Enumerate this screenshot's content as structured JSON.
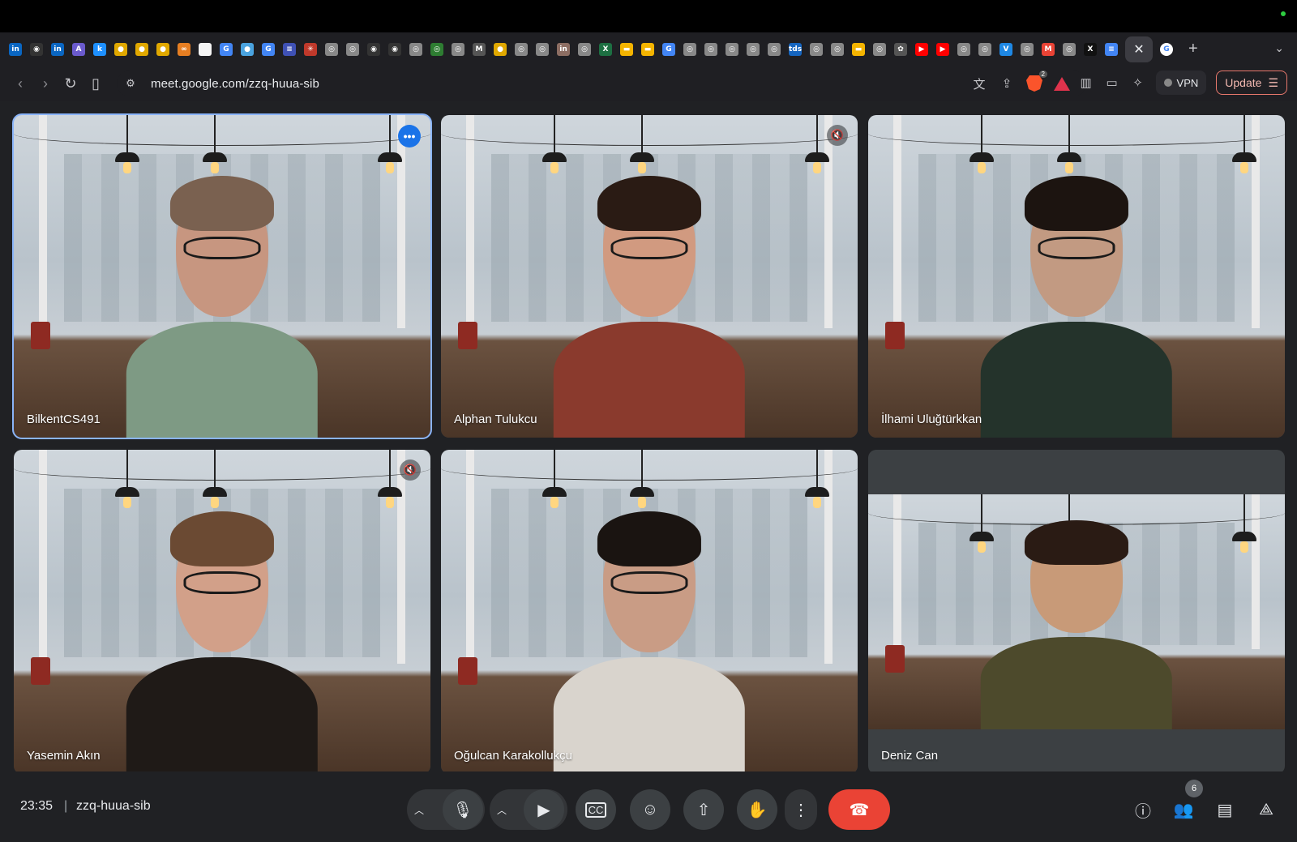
{
  "browser": {
    "url": "meet.google.com/zzq-huua-sib",
    "vpn_label": "VPN",
    "update_label": "Update",
    "brave_badge": "2",
    "favicons": [
      {
        "icon": "linkedin-icon",
        "color": "#0a66c2",
        "glyph": "in"
      },
      {
        "icon": "github-icon",
        "color": "#333",
        "glyph": "◉"
      },
      {
        "icon": "linkedin-icon",
        "color": "#0a66c2",
        "glyph": "in"
      },
      {
        "icon": "site-icon",
        "color": "#6a5acd",
        "glyph": "A"
      },
      {
        "icon": "site-icon",
        "color": "#1e90ff",
        "glyph": "k"
      },
      {
        "icon": "site-icon",
        "color": "#e0a800",
        "glyph": "●"
      },
      {
        "icon": "site-icon",
        "color": "#e0a800",
        "glyph": "●"
      },
      {
        "icon": "site-icon",
        "color": "#e0a800",
        "glyph": "●"
      },
      {
        "icon": "site-icon",
        "color": "#e67e22",
        "glyph": "∞"
      },
      {
        "icon": "site-icon",
        "color": "#f4f4f4",
        "glyph": ""
      },
      {
        "icon": "google-icon",
        "color": "#4285f4",
        "glyph": "G"
      },
      {
        "icon": "site-icon",
        "color": "#4aa3df",
        "glyph": "●"
      },
      {
        "icon": "google-icon",
        "color": "#4285f4",
        "glyph": "G"
      },
      {
        "icon": "site-icon",
        "color": "#3f51b5",
        "glyph": "≡"
      },
      {
        "icon": "site-icon",
        "color": "#c0392b",
        "glyph": "✳"
      },
      {
        "icon": "site-icon",
        "color": "#888",
        "glyph": "◎"
      },
      {
        "icon": "site-icon",
        "color": "#888",
        "glyph": "◎"
      },
      {
        "icon": "github-icon",
        "color": "#333",
        "glyph": "◉"
      },
      {
        "icon": "github-icon",
        "color": "#333",
        "glyph": "◉"
      },
      {
        "icon": "site-icon",
        "color": "#888",
        "glyph": "◎"
      },
      {
        "icon": "site-icon",
        "color": "#2e7d32",
        "glyph": "◎"
      },
      {
        "icon": "site-icon",
        "color": "#888",
        "glyph": "◎"
      },
      {
        "icon": "site-icon",
        "color": "#555",
        "glyph": "M"
      },
      {
        "icon": "site-icon",
        "color": "#e0a800",
        "glyph": "●"
      },
      {
        "icon": "site-icon",
        "color": "#888",
        "glyph": "◎"
      },
      {
        "icon": "site-icon",
        "color": "#888",
        "glyph": "◎"
      },
      {
        "icon": "site-icon",
        "color": "#8d6e63",
        "glyph": "in"
      },
      {
        "icon": "site-icon",
        "color": "#888",
        "glyph": "◎"
      },
      {
        "icon": "excel-icon",
        "color": "#1d6f42",
        "glyph": "X"
      },
      {
        "icon": "slides-icon",
        "color": "#f4b400",
        "glyph": "▬"
      },
      {
        "icon": "slides-icon",
        "color": "#f4b400",
        "glyph": "▬"
      },
      {
        "icon": "google-icon",
        "color": "#4285f4",
        "glyph": "G"
      },
      {
        "icon": "site-icon",
        "color": "#888",
        "glyph": "◎"
      },
      {
        "icon": "site-icon",
        "color": "#888",
        "glyph": "◎"
      },
      {
        "icon": "site-icon",
        "color": "#888",
        "glyph": "◎"
      },
      {
        "icon": "site-icon",
        "color": "#888",
        "glyph": "◎"
      },
      {
        "icon": "site-icon",
        "color": "#888",
        "glyph": "◎"
      },
      {
        "icon": "site-icon",
        "color": "#1565c0",
        "glyph": "tds"
      },
      {
        "icon": "site-icon",
        "color": "#888",
        "glyph": "◎"
      },
      {
        "icon": "site-icon",
        "color": "#888",
        "glyph": "◎"
      },
      {
        "icon": "slides-icon",
        "color": "#f4b400",
        "glyph": "▬"
      },
      {
        "icon": "site-icon",
        "color": "#888",
        "glyph": "◎"
      },
      {
        "icon": "openai-icon",
        "color": "#555",
        "glyph": "✿"
      },
      {
        "icon": "youtube-icon",
        "color": "#ff0000",
        "glyph": "▶"
      },
      {
        "icon": "youtube-icon",
        "color": "#ff0000",
        "glyph": "▶"
      },
      {
        "icon": "site-icon",
        "color": "#888",
        "glyph": "◎"
      },
      {
        "icon": "site-icon",
        "color": "#888",
        "glyph": "◎"
      },
      {
        "icon": "site-icon",
        "color": "#1e88e5",
        "glyph": "V"
      },
      {
        "icon": "site-icon",
        "color": "#888",
        "glyph": "◎"
      },
      {
        "icon": "gmail-icon",
        "color": "#ea4335",
        "glyph": "M"
      },
      {
        "icon": "site-icon",
        "color": "#888",
        "glyph": "◎"
      },
      {
        "icon": "x-icon",
        "color": "#111",
        "glyph": "X"
      },
      {
        "icon": "docs-icon",
        "color": "#4285f4",
        "glyph": "≡"
      }
    ]
  },
  "meeting": {
    "time": "23:35",
    "separator": "|",
    "code": "zzq-huua-sib",
    "participant_count": "6",
    "colors": {
      "accent": "#8ab4f8",
      "hangup": "#ea4335",
      "tile_bg": "#3c4043"
    }
  },
  "participants": [
    {
      "name": "BilkentCS491",
      "active_speaker": true,
      "muted": false,
      "shirt": "#7e9a84",
      "skin": "#c79680",
      "hair": "#7a6150"
    },
    {
      "name": "Alphan Tulukcu",
      "active_speaker": false,
      "muted": true,
      "shirt": "#8a3a2d",
      "skin": "#d19a80",
      "hair": "#2a1b14"
    },
    {
      "name": "İlhami Uluğtürkkan",
      "active_speaker": false,
      "muted": false,
      "shirt": "#24332b",
      "skin": "#c29a82",
      "hair": "#1c1410"
    },
    {
      "name": "Yasemin Akın",
      "active_speaker": false,
      "muted": true,
      "shirt": "#1f1a17",
      "skin": "#d2a089",
      "hair": "#6b4a33"
    },
    {
      "name": "Oğulcan Karakollukçu",
      "active_speaker": false,
      "muted": false,
      "shirt": "#d9d4cd",
      "skin": "#c99c85",
      "hair": "#1a1411"
    },
    {
      "name": "Deniz Can",
      "active_speaker": false,
      "muted": false,
      "shirt": "#4d4a2c",
      "skin": "#c89a78",
      "hair": "#2a1b14"
    }
  ]
}
